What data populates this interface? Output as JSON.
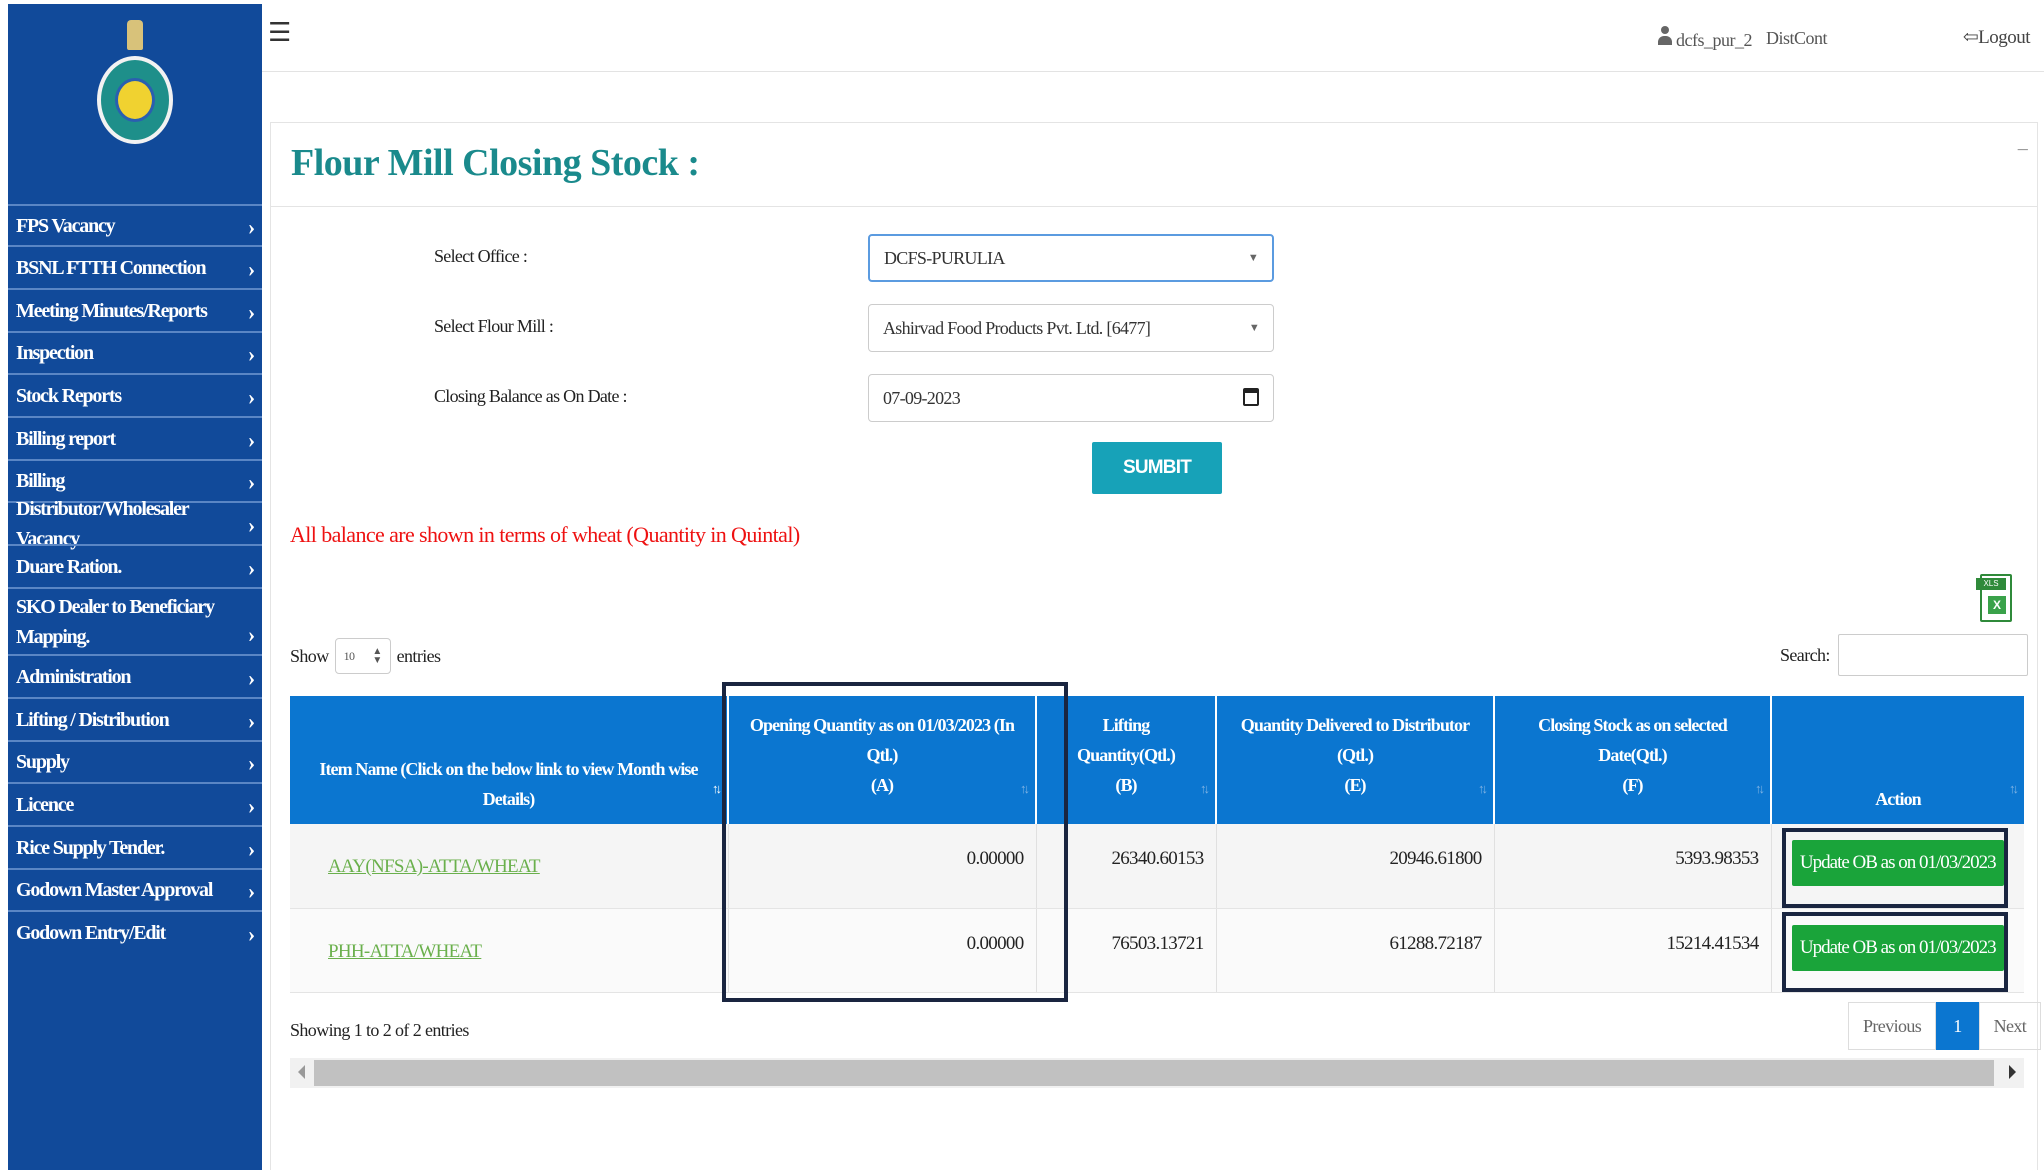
{
  "topbar": {
    "username": "dcfs_pur_2",
    "role": "DistCont",
    "logout_label": "Logout"
  },
  "sidebar": {
    "items": [
      {
        "label": "FPS Vacancy"
      },
      {
        "label": "BSNL FTTH Connection"
      },
      {
        "label": "Meeting Minutes/Reports"
      },
      {
        "label": "Inspection"
      },
      {
        "label": "Stock Reports"
      },
      {
        "label": "Billing report"
      },
      {
        "label": "Billing"
      },
      {
        "label": "Distributor/Wholesaler Vacancy"
      },
      {
        "label": "Duare Ration."
      },
      {
        "label": "SKO Dealer to Beneficiary Mapping."
      },
      {
        "label": "Administration"
      },
      {
        "label": "Lifting / Distribution"
      },
      {
        "label": "Supply"
      },
      {
        "label": "Licence"
      },
      {
        "label": "Rice Supply Tender."
      },
      {
        "label": "Godown Master Approval"
      },
      {
        "label": "Godown Entry/Edit"
      }
    ]
  },
  "page": {
    "title": "Flour Mill Closing Stock :",
    "collapse": "−"
  },
  "form": {
    "office_label": "Select Office :",
    "office_value": "DCFS-PURULIA",
    "mill_label": "Select Flour Mill :",
    "mill_value": "Ashirvad Food Products Pvt. Ltd. [6477]",
    "date_label": "Closing Balance as On Date :",
    "date_value": "07-09-2023",
    "submit_label": "SUMBIT"
  },
  "note": "All balance are shown in terms of wheat (Quantity in Quintal)",
  "table_controls": {
    "show_label": "Show",
    "entries_value": "10",
    "entries_label": "entries",
    "search_label": "Search:"
  },
  "table": {
    "headers": [
      "Item Name (Click on the below link to view Month wise Details)",
      "Opening Quantity as on 01/03/2023 (In Qtl.) (A)",
      "Lifting Quantity(Qtl.) (B)",
      "Quantity Delivered to Distributor (Qtl.) (E)",
      "Closing Stock as on selected Date(Qtl.) (F)",
      "Action"
    ],
    "header_lines": [
      [
        "Item Name (Click on the below link to view Month wise",
        "Details)"
      ],
      [
        "Opening Quantity as on 01/03/2023 (In",
        "Qtl.)",
        "(A)"
      ],
      [
        "Lifting",
        "Quantity(Qtl.)",
        "(B)"
      ],
      [
        "Quantity Delivered to Distributor",
        "(Qtl.)",
        "(E)"
      ],
      [
        "Closing Stock as on selected",
        "Date(Qtl.)",
        "(F)"
      ],
      [
        "Action"
      ]
    ],
    "rows": [
      {
        "item": "AAY(NFSA)-ATTA/WHEAT",
        "opening": "0.00000",
        "lifting": "26340.60153",
        "delivered": "20946.61800",
        "closing": "5393.98353",
        "action": "Update OB as on 01/03/2023"
      },
      {
        "item": "PHH-ATTA/WHEAT",
        "opening": "0.00000",
        "lifting": "76503.13721",
        "delivered": "61288.72187",
        "closing": "15214.41534",
        "action": "Update OB as on 01/03/2023"
      }
    ]
  },
  "footer": {
    "showing": "Showing 1 to 2 of 2 entries",
    "prev": "Previous",
    "page": "1",
    "next": "Next"
  },
  "icons": {
    "menu": "hamburger-icon",
    "user": "user-icon",
    "logout": "logout-icon",
    "excel": "excel-export-icon"
  },
  "colors": {
    "sidebar_bg": "#114a9a",
    "table_header_bg": "#0b76d0",
    "title": "#1a8a8c",
    "submit": "#17a2b8",
    "action_button": "#1aa43a",
    "note": "#ee1111",
    "link": "#6ab04c"
  }
}
